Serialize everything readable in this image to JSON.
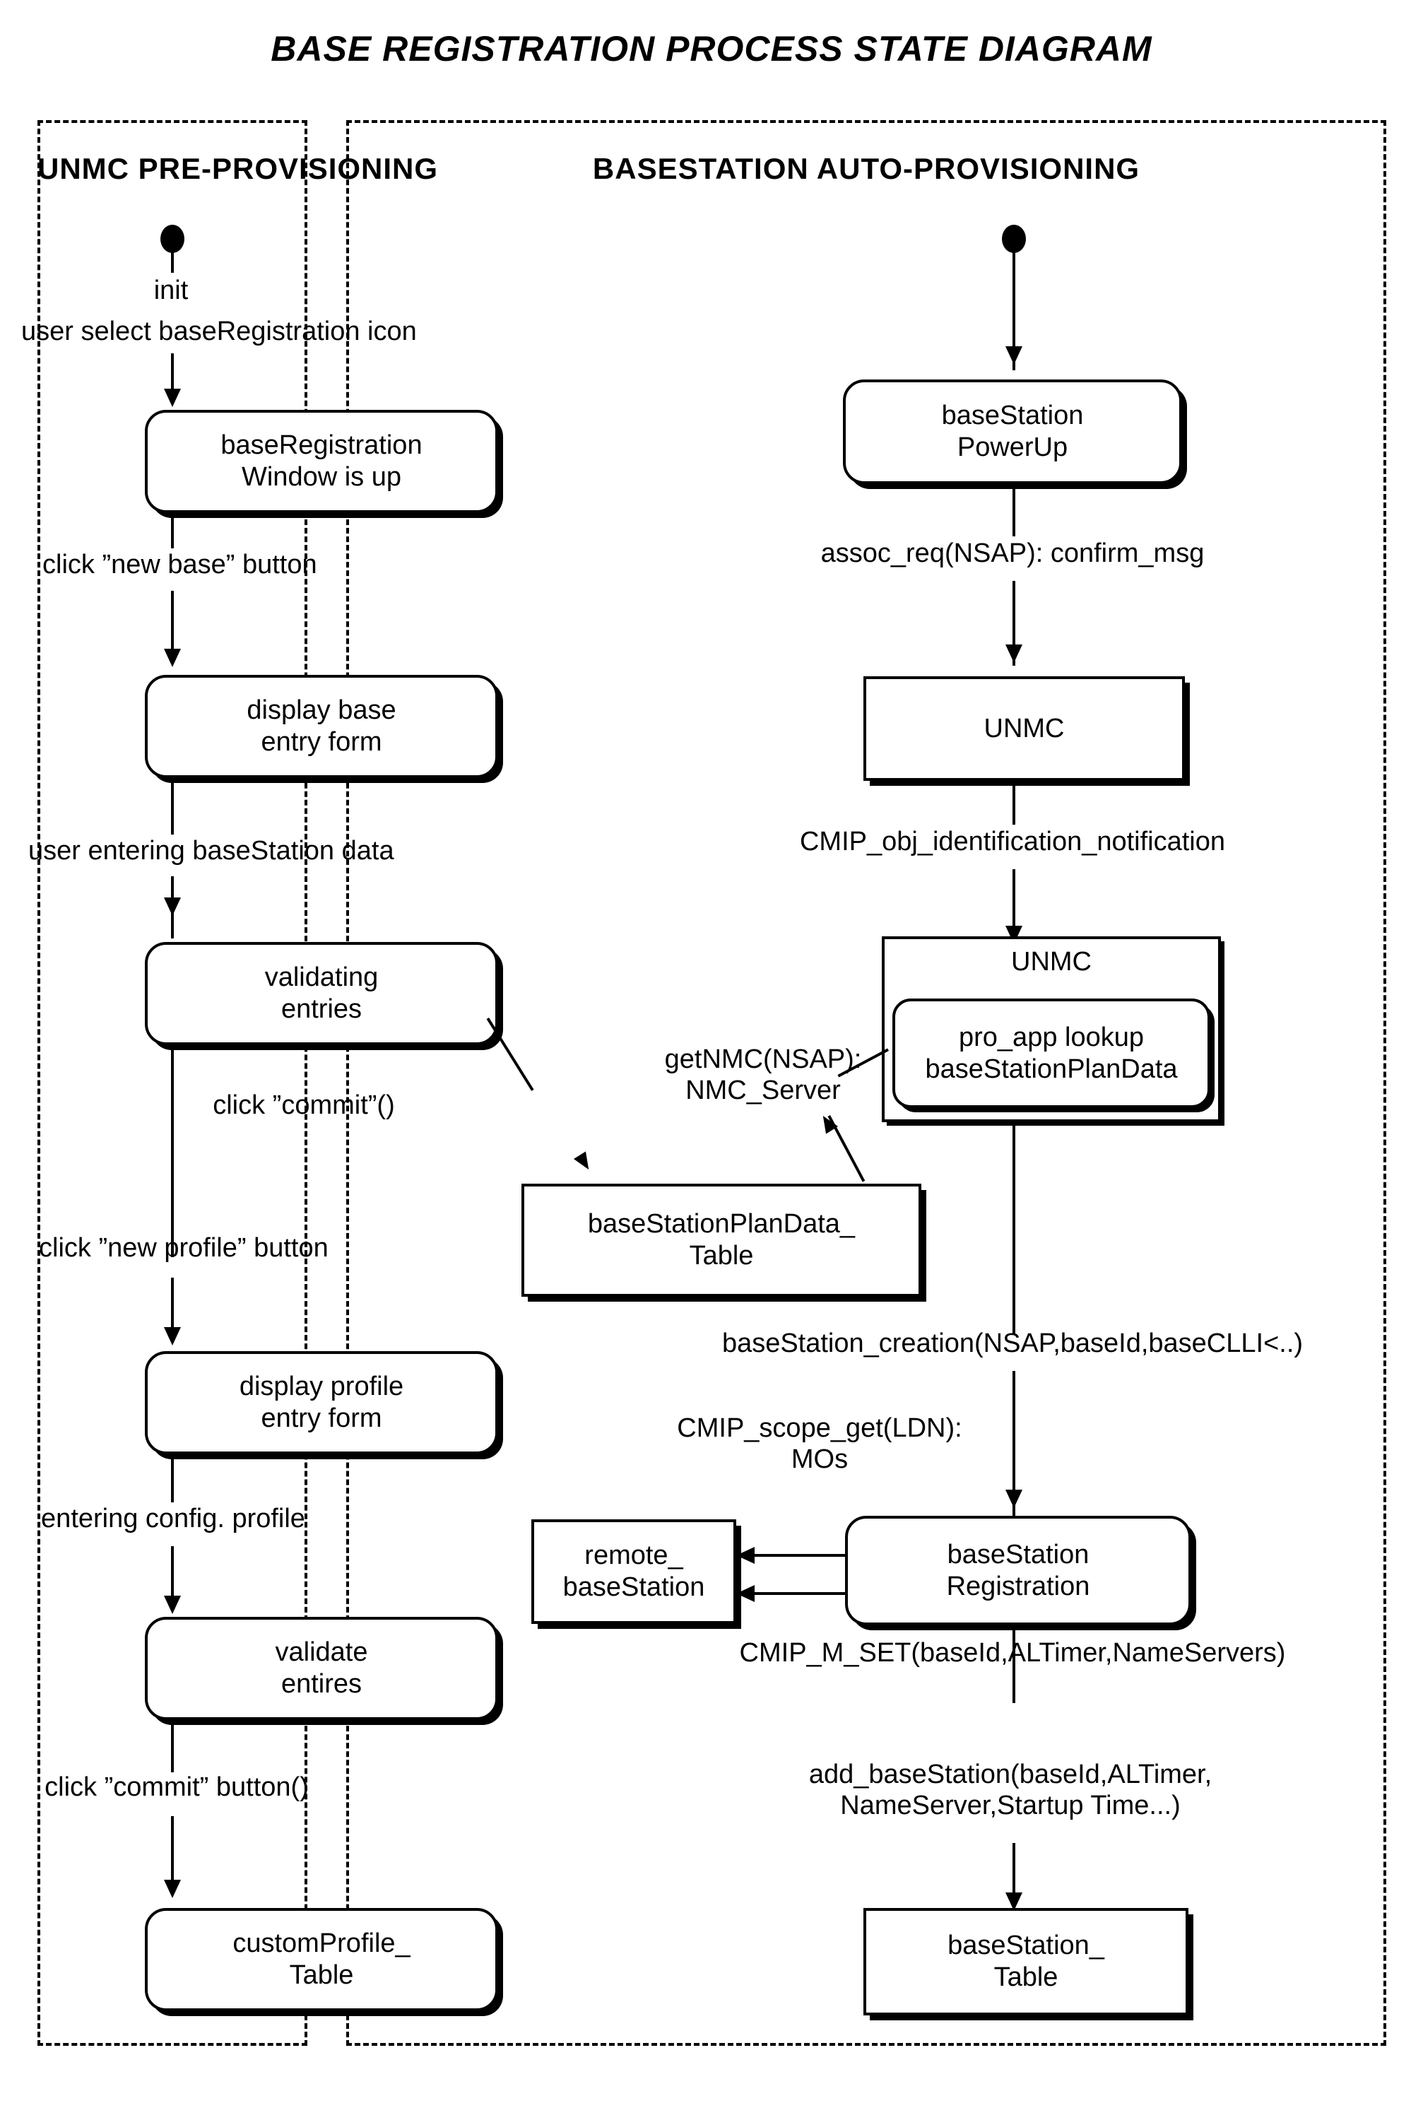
{
  "diagram": {
    "title": "BASE REGISTRATION PROCESS STATE DIAGRAM",
    "panels": {
      "left_title": "UNMC PRE-PROVISIONING",
      "right_title": "BASESTATION AUTO-PROVISIONING"
    }
  },
  "left": {
    "init_label": "init",
    "t1": "user select baseRegistration icon",
    "s1_line1": "baseRegistration",
    "s1_line2": "Window is up",
    "t2": "click ”new base” button",
    "s2_line1": "display base",
    "s2_line2": "entry form",
    "t3": "user entering baseStation data",
    "s3_line1": "validating",
    "s3_line2": "entries",
    "t4": "click ”commit”()",
    "t5": "click ”new profile” button",
    "s4_line1": "display profile",
    "s4_line2": "entry form",
    "t6": "entering config. profile",
    "s5_line1": "validate",
    "s5_line2": "entires",
    "t7": "click ”commit” button()",
    "s6_line1": "customProfile_",
    "s6_line2": "Table"
  },
  "right": {
    "r1_line1": "baseStation",
    "r1_line2": "PowerUp",
    "rt1": "assoc_req(NSAP): confirm_msg",
    "r2_line1": "UNMC",
    "rt2": "CMIP_obj_identification_notification",
    "r3_title": "UNMC",
    "r3_inner_line1": "pro_app lookup",
    "r3_inner_line2": "baseStationPlanData",
    "rt3_line1": "getNMC(NSAP):",
    "rt3_line2": "NMC_Server",
    "rt4": "baseStation_creation(NSAP,baseId,baseCLLI<..)",
    "rt5_line1": "CMIP_scope_get(LDN):",
    "rt5_line2": "MOs",
    "r4_line1": "baseStation",
    "r4_line2": "Registration",
    "rt6": "CMIP_M_SET(baseId,ALTimer,NameServers)",
    "rt7_line1": "add_baseStation(baseId,ALTimer,",
    "rt7_line2": "NameServer,Startup Time...)",
    "r5_line1": "baseStation_",
    "r5_line2": "Table"
  },
  "shared": {
    "table_line1": "baseStationPlanData_",
    "table_line2": "Table",
    "remote_line1": "remote_",
    "remote_line2": "baseStation"
  }
}
